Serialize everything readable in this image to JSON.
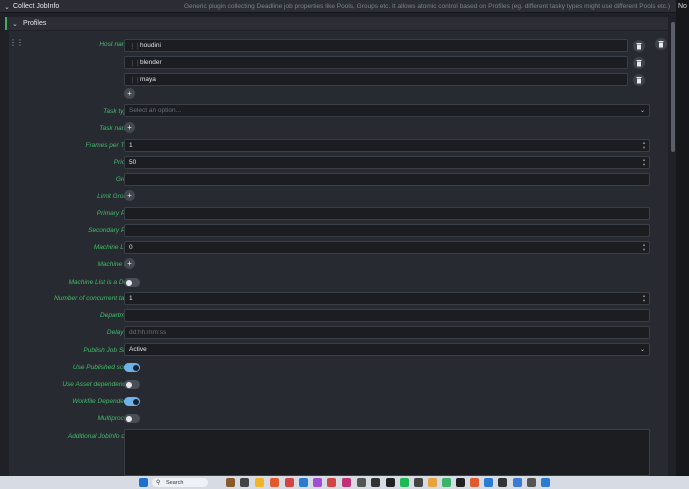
{
  "header": {
    "title": "Collect JobInfo",
    "description": "Generic plugin collecting Deadline job properties like Pools, Groups etc. It allows atomic control based on Profiles (eg. different tasky types might use different Pools etc.)",
    "right_cap": "No"
  },
  "profiles": {
    "title": "Profiles"
  },
  "host_names": {
    "label": "Host names",
    "items": [
      "houdini",
      "blender",
      "maya"
    ]
  },
  "task_types": {
    "label": "Task types",
    "placeholder": "Select an option..."
  },
  "task_names": {
    "label": "Task names"
  },
  "frames_per_task": {
    "label": "Frames per Task",
    "value": "1"
  },
  "priority": {
    "label": "Priority",
    "value": "50"
  },
  "group": {
    "label": "Group",
    "value": ""
  },
  "limit_groups": {
    "label": "Limit Groups"
  },
  "primary_pool": {
    "label": "Primary Pool",
    "value": ""
  },
  "secondary_pool": {
    "label": "Secondary Pool",
    "value": ""
  },
  "machine_limit": {
    "label": "Machine Limit",
    "value": "0"
  },
  "machine_list": {
    "label": "Machine List"
  },
  "machine_list_deny": {
    "label": "Machine List is a Deny",
    "on": false
  },
  "concurrent_tasks": {
    "label": "Number of concurrent tasks",
    "value": "1"
  },
  "department": {
    "label": "Department",
    "value": ""
  },
  "delay_job": {
    "label": "Delay job",
    "placeholder": "dd:hh:mm:ss"
  },
  "publish_job_state": {
    "label": "Publish Job State",
    "value": "Active"
  },
  "use_published": {
    "label": "Use Published scene",
    "on": true
  },
  "use_asset_deps": {
    "label": "Use Asset dependencies",
    "on": false
  },
  "workfile_dependency": {
    "label": "Workfile Dependency",
    "on": true
  },
  "multiprocess": {
    "label": "Multiprocess",
    "on": false
  },
  "additional_jobinfo": {
    "label": "Additional JobInfo data",
    "value": ""
  },
  "taskbar": {
    "search_label": "Search"
  },
  "colors": {
    "accent_green": "#3fbf6a",
    "toggle_on": "#6fb2e8"
  }
}
